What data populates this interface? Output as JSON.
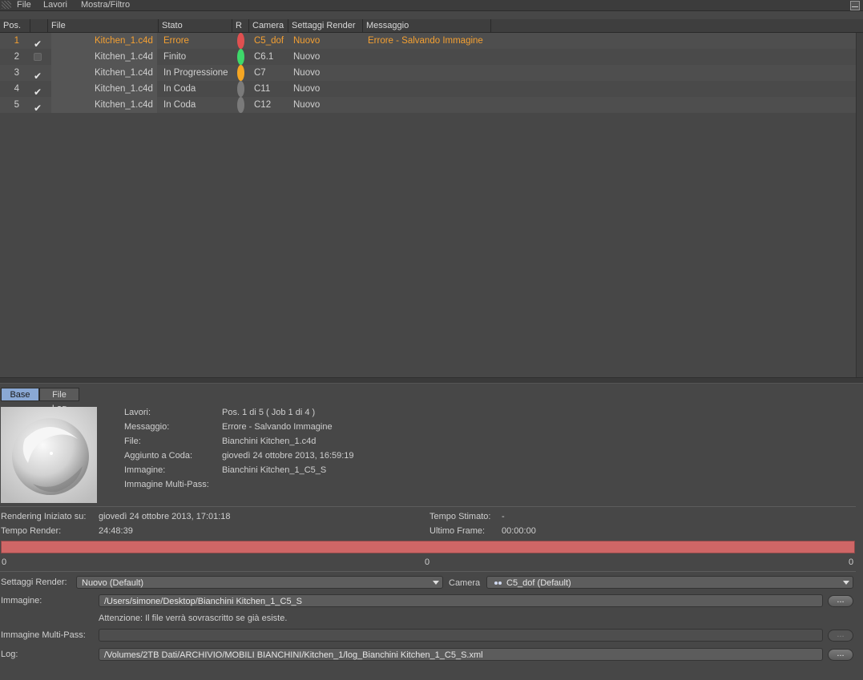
{
  "menu": {
    "items": [
      "File",
      "Lavori",
      "Mostra/Filtro"
    ]
  },
  "table": {
    "headers": [
      "Pos.",
      "",
      "File",
      "Stato",
      "R",
      "Camera",
      "Settaggi Render",
      "Messaggio"
    ],
    "rows": [
      {
        "pos": "1",
        "checked": true,
        "file": "Kitchen_1.c4d",
        "status": "Errore",
        "dot_color": "#e05050",
        "camera": "C5_dof",
        "settings": "Nuovo",
        "message": "Errore - Salvando Immagine"
      },
      {
        "pos": "2",
        "checked": false,
        "file": "Kitchen_1.c4d",
        "status": "Finito",
        "dot_color": "#3ed86a",
        "camera": "C6.1",
        "settings": "Nuovo",
        "message": ""
      },
      {
        "pos": "3",
        "checked": true,
        "file": "Kitchen_1.c4d",
        "status": "In Progressione",
        "dot_color": "#f5a623",
        "camera": "C7",
        "settings": "Nuovo",
        "message": ""
      },
      {
        "pos": "4",
        "checked": true,
        "file": "Kitchen_1.c4d",
        "status": "In Coda",
        "dot_color": "#7a7a7a",
        "camera": "C11",
        "settings": "Nuovo",
        "message": ""
      },
      {
        "pos": "5",
        "checked": true,
        "file": "Kitchen_1.c4d",
        "status": "In Coda",
        "dot_color": "#7a7a7a",
        "camera": "C12",
        "settings": "Nuovo",
        "message": ""
      }
    ]
  },
  "tabs": {
    "base": "Base",
    "log": "File Log"
  },
  "details": {
    "labels": [
      "Lavori:",
      "Messaggio:",
      "File:",
      "Aggiunto a Coda:",
      "Immagine:",
      "Immagine Multi-Pass:"
    ],
    "values": [
      "Pos. 1 di 5 ( Job 1 di 4 )",
      "Errore - Salvando Immagine",
      "Bianchini Kitchen_1.c4d",
      "giovedì 24 ottobre 2013, 16:59:19",
      "Bianchini Kitchen_1_C5_S",
      ""
    ]
  },
  "render": {
    "started_label": "Rendering Iniziato su:",
    "started_value": "giovedì 24 ottobre 2013, 17:01:18",
    "time_label": "Tempo Render:",
    "time_value": "24:48:39",
    "estimated_label": "Tempo Stimato:",
    "estimated_value": "-",
    "last_frame_label": "Ultimo Frame:",
    "last_frame_value": "00:00:00",
    "progress": 1.0,
    "progress_left": "0",
    "progress_mid": "0",
    "progress_right": "0"
  },
  "settings": {
    "render_label": "Settaggi Render:",
    "render_value": "Nuovo (Default)",
    "camera_label": "Camera",
    "camera_value": "C5_dof (Default)",
    "image_label": "Immagine:",
    "image_path": "/Users/simone/Desktop/Bianchini Kitchen_1_C5_S",
    "warning": "Attenzione: Il file verrà sovrascritto se già esiste.",
    "multipass_label": "Immagine Multi-Pass:",
    "multipass_path": "",
    "log_label": "Log:",
    "log_path": "/Volumes/2TB Dati/ARCHIVIO/MOBILI BIANCHINI/Kitchen_1/log_Bianchini Kitchen_1_C5_S.xml",
    "browse_label": "..."
  },
  "colors": {
    "accent_error": "#f4a032",
    "tab_active": "#8aa8d4",
    "progress_fill": "#cf6666"
  }
}
